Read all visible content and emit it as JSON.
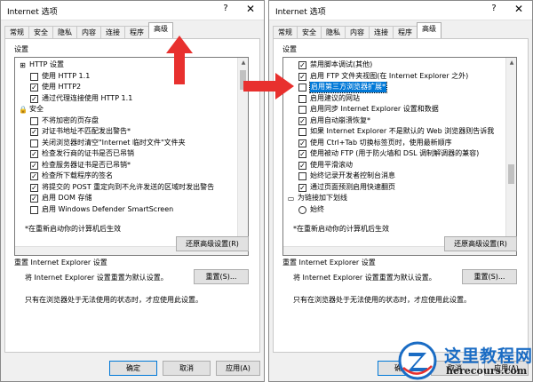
{
  "left_dialog": {
    "title": "Internet 选项",
    "help_icon": "?",
    "close_icon": "✕",
    "tabs": [
      "常规",
      "安全",
      "隐私",
      "内容",
      "连接",
      "程序",
      "高级"
    ],
    "active_tab": 6,
    "settings_label": "设置",
    "items": [
      {
        "type": "group",
        "icon": "globe-icon",
        "text": "HTTP 设置"
      },
      {
        "type": "check",
        "indent": 1,
        "checked": false,
        "text": "使用 HTTP 1.1"
      },
      {
        "type": "check",
        "indent": 1,
        "checked": true,
        "text": "使用 HTTP2"
      },
      {
        "type": "check",
        "indent": 1,
        "checked": true,
        "text": "通过代理连接使用 HTTP 1.1"
      },
      {
        "type": "group",
        "icon": "lock-icon",
        "text": "安全"
      },
      {
        "type": "check",
        "indent": 1,
        "checked": false,
        "text": "不将加密的页存盘"
      },
      {
        "type": "check",
        "indent": 1,
        "checked": true,
        "text": "对证书地址不匹配发出警告*"
      },
      {
        "type": "check",
        "indent": 1,
        "checked": false,
        "text": "关闭浏览器时清空\"Internet 临时文件\"文件夹"
      },
      {
        "type": "check",
        "indent": 1,
        "checked": true,
        "text": "检查发行商的证书是否已吊销"
      },
      {
        "type": "check",
        "indent": 1,
        "checked": true,
        "text": "检查服务器证书是否已吊销*"
      },
      {
        "type": "check",
        "indent": 1,
        "checked": true,
        "text": "检查所下载程序的签名"
      },
      {
        "type": "check",
        "indent": 1,
        "checked": true,
        "text": "将提交的 POST 重定向到不允许发送的区域时发出警告"
      },
      {
        "type": "check",
        "indent": 1,
        "checked": true,
        "text": "启用 DOM 存储"
      },
      {
        "type": "check",
        "indent": 1,
        "checked": false,
        "text": "启用 Windows Defender SmartScreen"
      }
    ],
    "restart_note": "*在重新启动你的计算机后生效",
    "restore_button": "还原高级设置(R)",
    "reset_section": "重置 Internet Explorer 设置",
    "reset_desc": "将 Internet Explorer 设置重置为默认设置。",
    "reset_button": "重置(S)...",
    "reset_note": "只有在浏览器处于无法使用的状态时，才应使用此设置。",
    "ok_button": "确定",
    "cancel_button": "取消",
    "apply_button": "应用(A)"
  },
  "right_dialog": {
    "title": "Internet 选项",
    "help_icon": "?",
    "close_icon": "✕",
    "tabs": [
      "常规",
      "安全",
      "隐私",
      "内容",
      "连接",
      "程序",
      "高级"
    ],
    "active_tab": 6,
    "settings_label": "设置",
    "items": [
      {
        "type": "check",
        "indent": 1,
        "checked": true,
        "text": "禁用脚本调试(其他)"
      },
      {
        "type": "check",
        "indent": 1,
        "checked": true,
        "text": "启用 FTP 文件夹视图(在 Internet Explorer 之外)"
      },
      {
        "type": "check",
        "indent": 1,
        "checked": false,
        "selected": true,
        "text": "启用第三方浏览器扩展*"
      },
      {
        "type": "check",
        "indent": 1,
        "checked": false,
        "text": "启用建议的网站"
      },
      {
        "type": "check",
        "indent": 1,
        "checked": false,
        "text": "启用同步 Internet Explorer 设置和数据"
      },
      {
        "type": "check",
        "indent": 1,
        "checked": true,
        "text": "启用自动崩溃恢复*"
      },
      {
        "type": "check",
        "indent": 1,
        "checked": false,
        "text": "如果 Internet Explorer 不是默认的 Web 浏览器则告诉我"
      },
      {
        "type": "check",
        "indent": 1,
        "checked": true,
        "text": "使用 Ctrl+Tab 切换标签页时，使用最新顺序"
      },
      {
        "type": "check",
        "indent": 1,
        "checked": true,
        "text": "使用被动 FTP (用于防火墙和 DSL 调制解调器的兼容)"
      },
      {
        "type": "check",
        "indent": 1,
        "checked": true,
        "text": "使用平滑滚动"
      },
      {
        "type": "check",
        "indent": 1,
        "checked": false,
        "text": "始终记录开发者控制台消息"
      },
      {
        "type": "check",
        "indent": 1,
        "checked": true,
        "text": "通过页面预测启用快速翻页"
      },
      {
        "type": "group",
        "icon": "link-underline-icon",
        "text": "为链接加下划线"
      },
      {
        "type": "radio",
        "indent": 1,
        "checked": false,
        "text": "始终"
      }
    ],
    "restart_note": "*在重新启动你的计算机后生效",
    "restore_button": "还原高级设置(R)",
    "reset_section": "重置 Internet Explorer 设置",
    "reset_desc": "将 Internet Explorer 设置重置为默认设置。",
    "reset_button": "重置(S)...",
    "reset_note": "只有在浏览器处于无法使用的状态时，才应使用此设置。",
    "ok_button": "确定",
    "cancel_button": "取消",
    "apply_button": "应用(A)"
  },
  "watermark": {
    "name": "这里教程网",
    "url": "herecours.com",
    "brand_color": "#1a6cc4"
  },
  "annotation_color": "#e8302e"
}
